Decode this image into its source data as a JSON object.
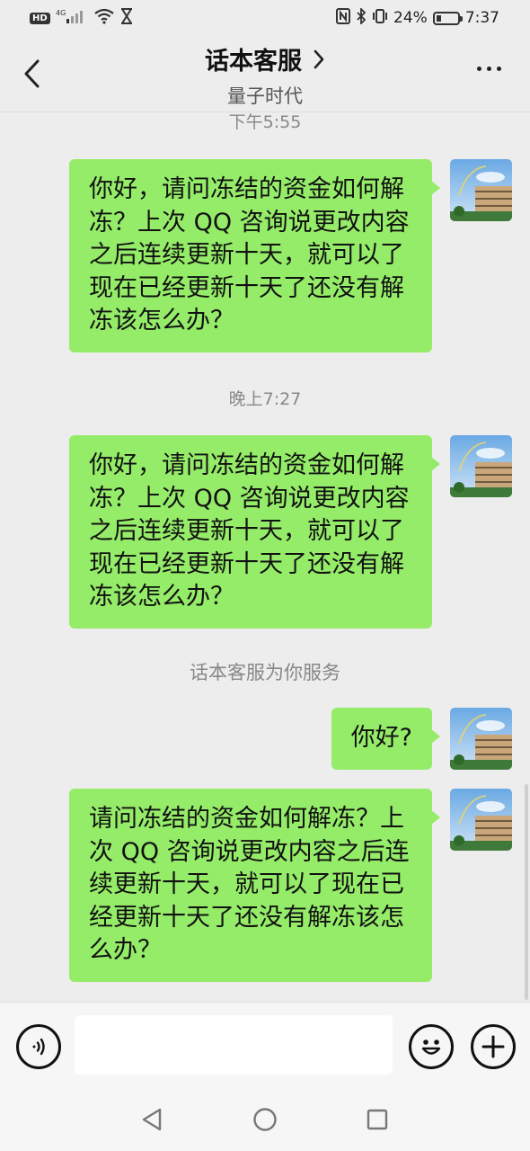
{
  "status_bar": {
    "hd": "HD",
    "network": "4G",
    "battery_percent": "24%",
    "battery_level": 0.24,
    "time": "7:37"
  },
  "header": {
    "title": "话本客服",
    "subtitle": "量子时代"
  },
  "chat": {
    "timestamp_1": "下午5:55",
    "message_1": "你好，请问冻结的资金如何解冻？上次 QQ 咨询说更改内容之后连续更新十天，就可以了现在已经更新十天了还没有解冻该怎么办？",
    "timestamp_2": "晚上7:27",
    "message_2": "你好，请问冻结的资金如何解冻？上次 QQ 咨询说更改内容之后连续更新十天，就可以了现在已经更新十天了还没有解冻该怎么办？",
    "system_notice": "话本客服为你服务",
    "message_3": "你好?",
    "message_4": "请问冻结的资金如何解冻？上次 QQ 咨询说更改内容之后连续更新十天，就可以了现在已经更新十天了还没有解冻该怎么办？"
  },
  "input": {
    "value": "",
    "placeholder": ""
  },
  "colors": {
    "bubble": "#95ec69",
    "background": "#ededed",
    "input_bar": "#f6f6f6"
  },
  "icons": {
    "back": "chevron-left-icon",
    "title_arrow": "chevron-right-icon",
    "more": "more-icon",
    "voice": "voice-icon",
    "emoji": "emoji-icon",
    "add": "plus-icon",
    "nav_back": "triangle-back-icon",
    "nav_home": "circle-home-icon",
    "nav_recent": "square-recent-icon"
  }
}
